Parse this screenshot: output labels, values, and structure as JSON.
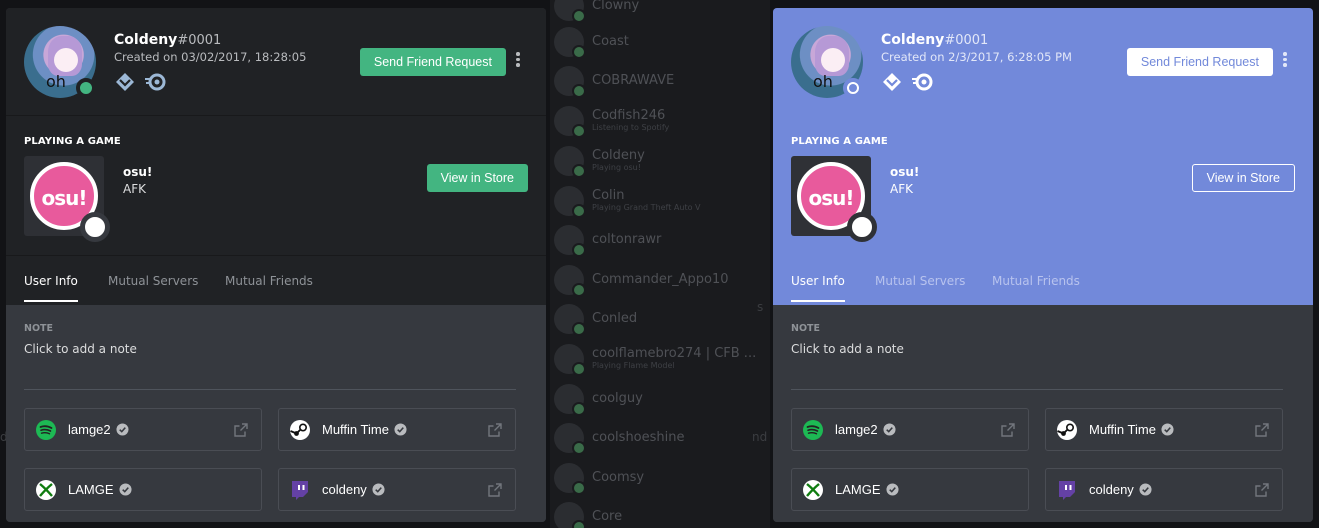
{
  "background_list": {
    "members": [
      {
        "name": "Clowny",
        "sub": ""
      },
      {
        "name": "Coast",
        "sub": ""
      },
      {
        "name": "COBRAWAVE",
        "sub": ""
      },
      {
        "name": "Codfish246",
        "sub": "Listening to Spotify"
      },
      {
        "name": "Coldeny",
        "sub": "Playing osu!"
      },
      {
        "name": "Colin",
        "sub": "Playing Grand Theft Auto V"
      },
      {
        "name": "coltonrawr",
        "sub": ""
      },
      {
        "name": "Commander_Appo10",
        "sub": ""
      },
      {
        "name": "Conled",
        "sub": ""
      },
      {
        "name": "coolflamebro274 | CFB ...",
        "sub": "Playing Flame Model"
      },
      {
        "name": "coolguy",
        "sub": ""
      },
      {
        "name": "coolshoeshine",
        "sub": ""
      },
      {
        "name": "Coomsy",
        "sub": ""
      },
      {
        "name": "Core",
        "sub": ""
      }
    ],
    "fragments": {
      "left": "s",
      "right": "nd",
      "right2": "d"
    }
  },
  "profiles": [
    {
      "username": "Coldeny",
      "discriminator": "#0001",
      "created": "Created on 03/02/2017, 18:28:05",
      "send_friend_label": "Send Friend Request",
      "playing_label": "PLAYING A GAME",
      "game_name": "osu!",
      "game_state": "AFK",
      "game_art_text": "osu!",
      "store_label": "View in Store",
      "tabs": [
        "User Info",
        "Mutual Servers",
        "Mutual Friends"
      ],
      "note_label": "NOTE",
      "note_placeholder": "Click to add a note",
      "avatar_text": "oh",
      "connections": [
        {
          "service": "spotify-icon",
          "name": "lamge2"
        },
        {
          "service": "steam-icon",
          "name": "Muffin Time"
        },
        {
          "service": "xbox-icon",
          "name": "LAMGE"
        },
        {
          "service": "twitch-icon",
          "name": "coldeny"
        }
      ]
    },
    {
      "username": "Coldeny",
      "discriminator": "#0001",
      "created": "Created on 2/3/2017, 6:28:05 PM",
      "send_friend_label": "Send Friend Request",
      "playing_label": "PLAYING A GAME",
      "game_name": "osu!",
      "game_state": "AFK",
      "game_art_text": "osu!",
      "store_label": "View in Store",
      "tabs": [
        "User Info",
        "Mutual Servers",
        "Mutual Friends"
      ],
      "note_label": "NOTE",
      "note_placeholder": "Click to add a note",
      "avatar_text": "oh",
      "connections": [
        {
          "service": "spotify-icon",
          "name": "lamge2"
        },
        {
          "service": "steam-icon",
          "name": "Muffin Time"
        },
        {
          "service": "xbox-icon",
          "name": "LAMGE"
        },
        {
          "service": "twitch-icon",
          "name": "coldeny"
        }
      ]
    }
  ],
  "colors": {
    "dark_header": "#202225",
    "blurple": "#7289da",
    "green": "#43b581",
    "body": "#36393f"
  }
}
